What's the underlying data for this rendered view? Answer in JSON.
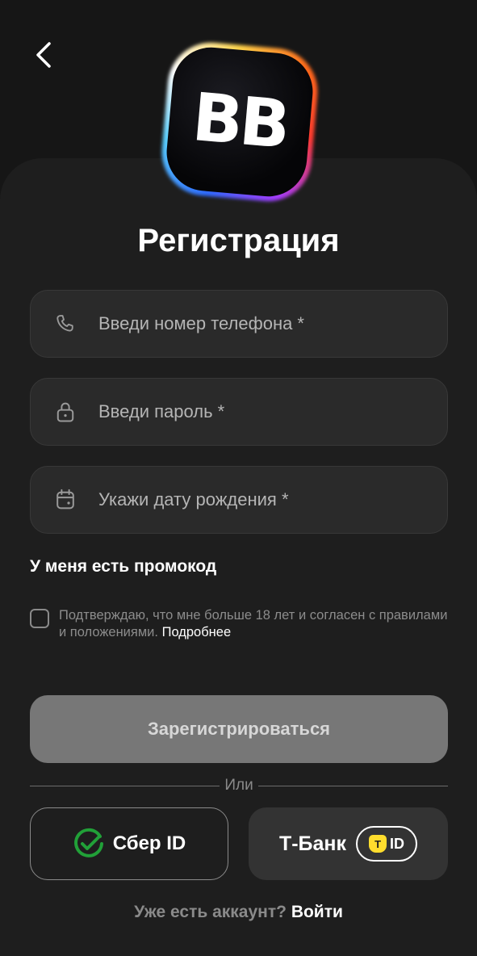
{
  "header": {
    "back_icon": "chevron-left-icon"
  },
  "logo": {
    "text": "BB"
  },
  "title": "Регистрация",
  "fields": {
    "phone": {
      "icon": "phone-icon",
      "placeholder": "Введи номер телефона *"
    },
    "password": {
      "icon": "lock-icon",
      "placeholder": "Введи пароль *"
    },
    "birthdate": {
      "icon": "calendar-icon",
      "placeholder": "Укажи дату рождения *"
    }
  },
  "promo_label": "У меня есть промокод",
  "consent": {
    "checked": false,
    "text": "Подтверждаю, что мне больше 18 лет и согласен с правилами и положениями.",
    "link": "Подробнее"
  },
  "register_button": "Зарегистрироваться",
  "divider_text": "Или",
  "sber": {
    "label": "Сбер ID",
    "color": "#21a038"
  },
  "tbank": {
    "label": "Т-Банк",
    "badge_letter": "T",
    "badge_text": "ID",
    "badge_color": "#ffdd2d"
  },
  "signin": {
    "question": "Уже есть аккаунт?",
    "link": "Войти"
  },
  "colors": {
    "background": "#161616",
    "sheet": "#1e1e1e",
    "field": "#2a2a2a",
    "button_disabled": "#777777"
  }
}
